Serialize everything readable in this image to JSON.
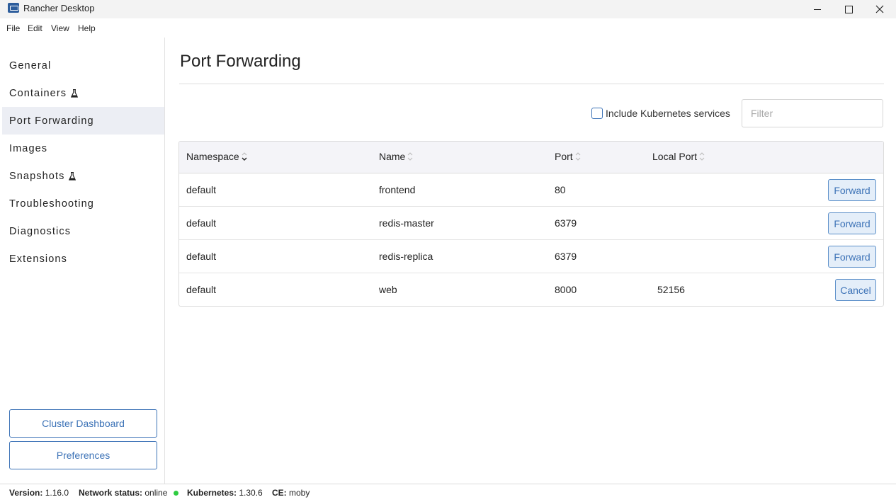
{
  "window": {
    "title": "Rancher Desktop"
  },
  "menu": [
    "File",
    "Edit",
    "View",
    "Help"
  ],
  "sidebar": {
    "items": [
      {
        "label": "General",
        "experimental": false
      },
      {
        "label": "Containers",
        "experimental": true
      },
      {
        "label": "Port Forwarding",
        "experimental": false,
        "active": true
      },
      {
        "label": "Images",
        "experimental": false
      },
      {
        "label": "Snapshots",
        "experimental": true
      },
      {
        "label": "Troubleshooting",
        "experimental": false
      },
      {
        "label": "Diagnostics",
        "experimental": false
      },
      {
        "label": "Extensions",
        "experimental": false
      }
    ],
    "buttons": {
      "cluster_dashboard": "Cluster Dashboard",
      "preferences": "Preferences"
    }
  },
  "main": {
    "title": "Port Forwarding",
    "include_k8s_label": "Include Kubernetes services",
    "include_k8s_checked": false,
    "filter_placeholder": "Filter",
    "table": {
      "columns": [
        "Namespace",
        "Name",
        "Port",
        "Local Port"
      ],
      "rows": [
        {
          "namespace": "default",
          "name": "frontend",
          "port": "80",
          "local_port": "",
          "action": "Forward"
        },
        {
          "namespace": "default",
          "name": "redis-master",
          "port": "6379",
          "local_port": "",
          "action": "Forward"
        },
        {
          "namespace": "default",
          "name": "redis-replica",
          "port": "6379",
          "local_port": "",
          "action": "Forward"
        },
        {
          "namespace": "default",
          "name": "web",
          "port": "8000",
          "local_port": "52156",
          "action": "Cancel"
        }
      ]
    }
  },
  "status": {
    "version_label": "Version:",
    "version": "1.16.0",
    "network_label": "Network status:",
    "network": "online",
    "kubernetes_label": "Kubernetes:",
    "kubernetes": "1.30.6",
    "ce_label": "CE:",
    "ce": "moby"
  },
  "colors": {
    "accent": "#3d73b7",
    "online": "#2ecc40",
    "active_nav_bg": "#eceef4"
  }
}
